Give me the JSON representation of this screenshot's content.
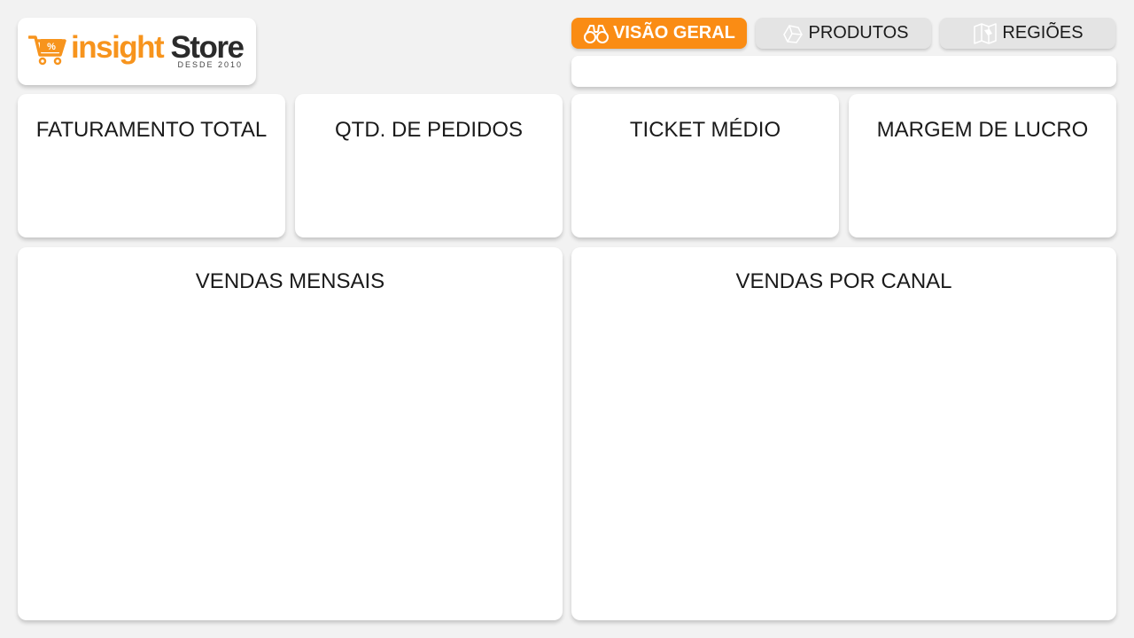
{
  "logo": {
    "word_primary": "insight",
    "word_secondary": "Store",
    "tagline": "DESDE 2010",
    "cart_badge": "%"
  },
  "nav": {
    "tabs": [
      {
        "label": "VISÃO GERAL",
        "icon": "binoculars-icon",
        "active": true
      },
      {
        "label": "PRODUTOS",
        "icon": "box-icon",
        "active": false
      },
      {
        "label": "REGIÕES",
        "icon": "map-icon",
        "active": false
      }
    ]
  },
  "kpis": [
    {
      "title": "FATURAMENTO TOTAL"
    },
    {
      "title": "QTD. DE PEDIDOS"
    },
    {
      "title": "TICKET MÉDIO"
    },
    {
      "title": "MARGEM DE LUCRO"
    }
  ],
  "charts": {
    "monthly_sales_title": "VENDAS MENSAIS",
    "channel_sales_title": "VENDAS POR CANAL"
  },
  "colors": {
    "accent": "#fa8c14",
    "background": "#f2f2f2",
    "card": "#ffffff",
    "tab_inactive": "#e4e4e4",
    "logo_dark": "#2b2b2b"
  }
}
